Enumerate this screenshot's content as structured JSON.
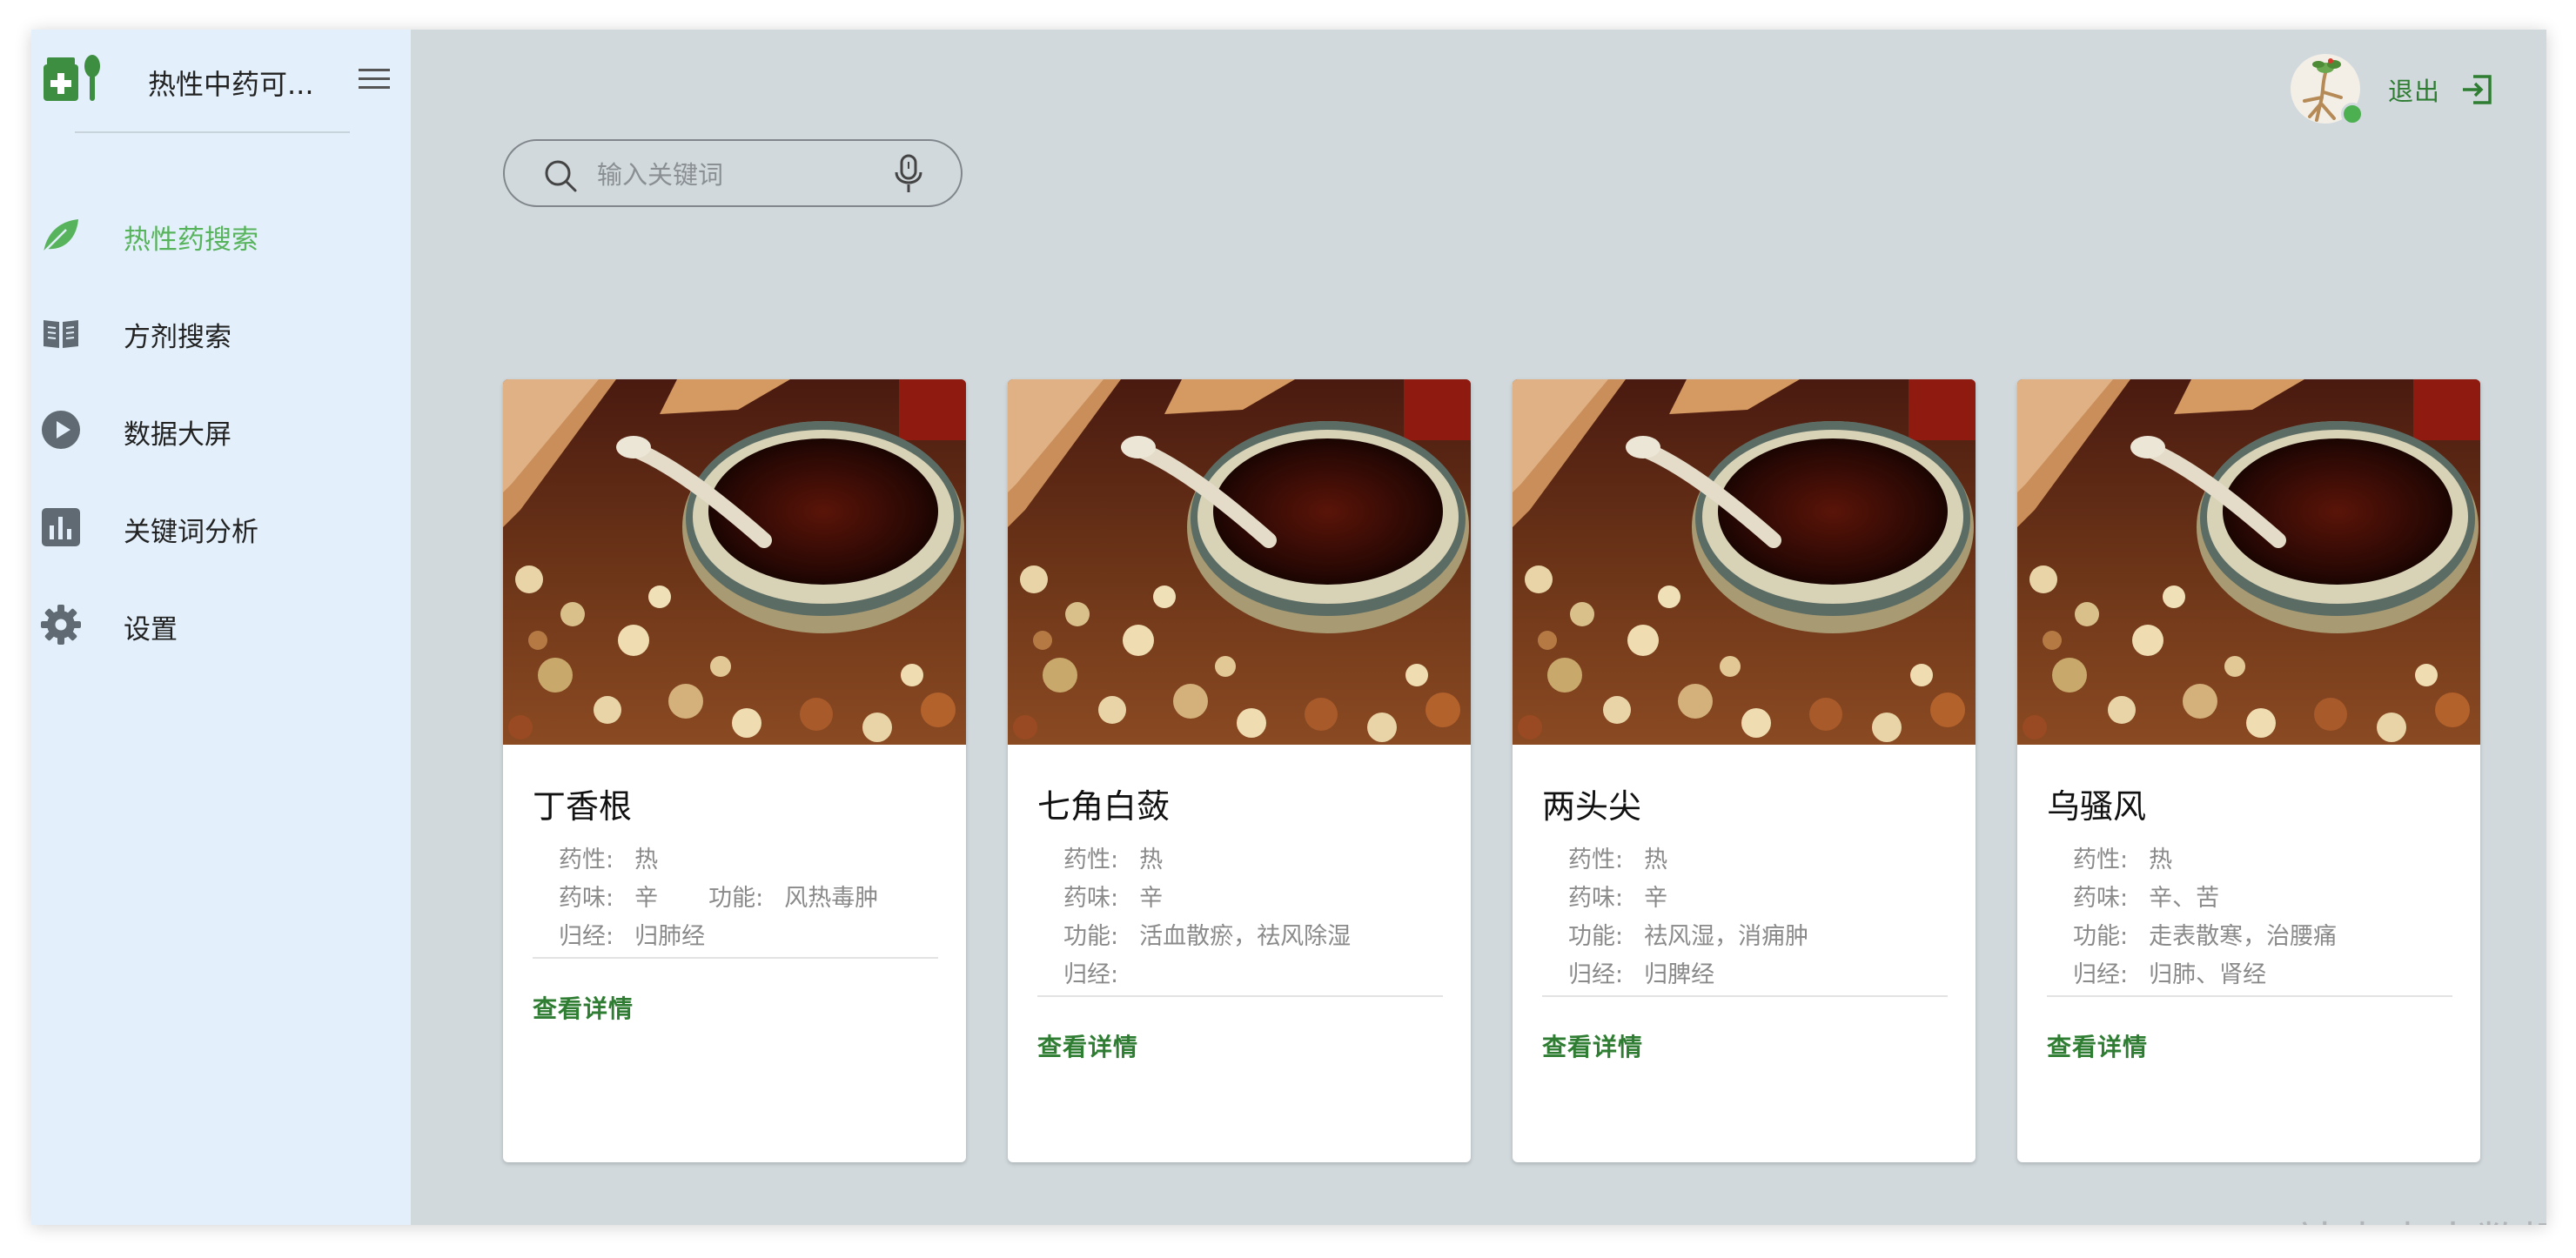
{
  "app": {
    "title": "热性中药可..."
  },
  "sidebar": {
    "items": [
      {
        "label": "热性药搜索",
        "icon": "leaf-icon",
        "active": true
      },
      {
        "label": "方剂搜索",
        "icon": "book-icon",
        "active": false
      },
      {
        "label": "数据大屏",
        "icon": "play-circle-icon",
        "active": false
      },
      {
        "label": "关键词分析",
        "icon": "bar-chart-icon",
        "active": false
      },
      {
        "label": "设置",
        "icon": "gear-icon",
        "active": false
      }
    ]
  },
  "search": {
    "placeholder": "输入关键词",
    "value": ""
  },
  "header": {
    "logout_label": "退出"
  },
  "cards": [
    {
      "name": "丁香根",
      "property_label": "药性:",
      "property": "热",
      "flavor_label": "药味:",
      "flavor": "辛",
      "function_label": "功能:",
      "function": "风热毒肿",
      "meridian_label": "归经:",
      "meridian": "归肺经",
      "detail_label": "查看详情"
    },
    {
      "name": "七角白蔹",
      "property_label": "药性:",
      "property": "热",
      "flavor_label": "药味:",
      "flavor": "辛",
      "function_label": "功能:",
      "function": "活血散瘀，祛风除湿",
      "meridian_label": "归经:",
      "meridian": "",
      "detail_label": "查看详情"
    },
    {
      "name": "两头尖",
      "property_label": "药性:",
      "property": "热",
      "flavor_label": "药味:",
      "flavor": "辛",
      "function_label": "功能:",
      "function": "祛风湿，消痈肿",
      "meridian_label": "归经:",
      "meridian": "归脾经",
      "detail_label": "查看详情"
    },
    {
      "name": "乌骚风",
      "property_label": "药性:",
      "property": "热",
      "flavor_label": "药味:",
      "flavor": "辛、苦",
      "function_label": "功能:",
      "function": "走表散寒，治腰痛",
      "meridian_label": "归经:",
      "meridian": "归肺、肾经",
      "detail_label": "查看详情"
    }
  ],
  "watermark": "CSDN @B站麦麦大数据",
  "colors": {
    "accent": "#58b35d",
    "primary": "#2e7d32",
    "sidebar_bg": "#e3f0fb",
    "page_bg": "#d1d9dd"
  }
}
